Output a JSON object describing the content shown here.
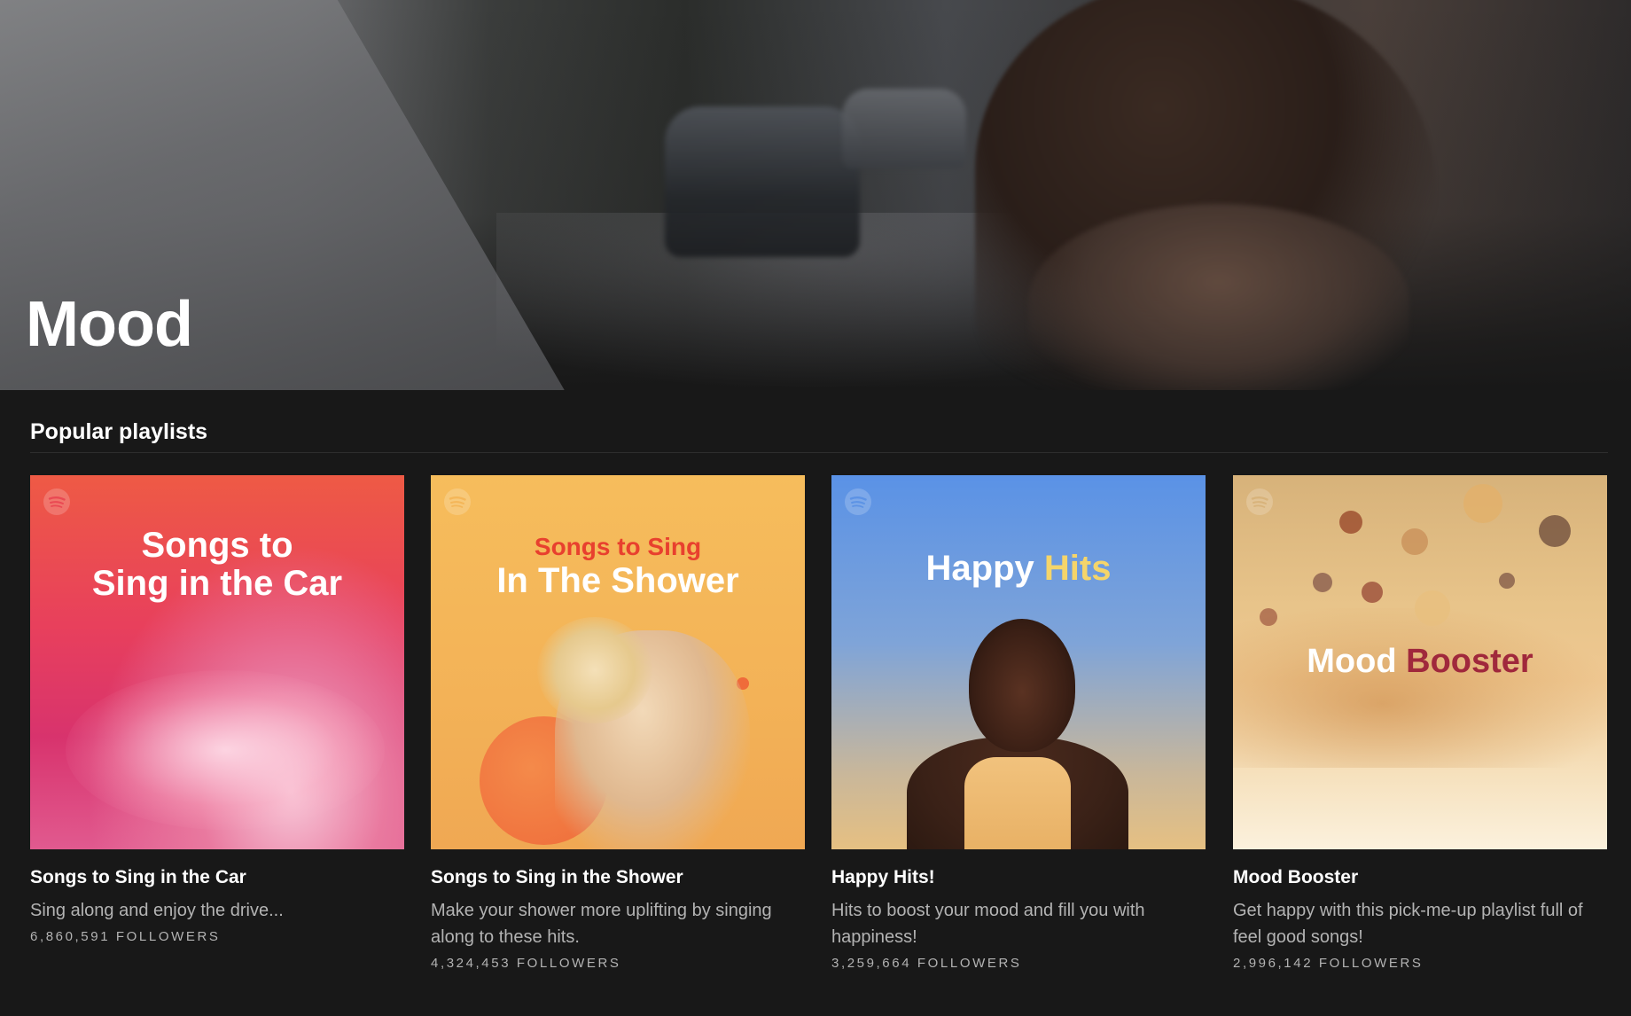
{
  "header": {
    "title": "Mood"
  },
  "section": {
    "title": "Popular playlists"
  },
  "playlists": [
    {
      "title": "Songs to Sing in the Car",
      "description": "Sing along and enjoy the drive...",
      "followers": "6,860,591 FOLLOWERS",
      "cover_line1": "Songs to",
      "cover_line2": "Sing in the Car"
    },
    {
      "title": "Songs to Sing in the Shower",
      "description": "Make your shower more uplifting by singing along to these hits.",
      "followers": "4,324,453 FOLLOWERS",
      "cover_line1": "Songs to Sing",
      "cover_line2": "In The Shower"
    },
    {
      "title": "Happy Hits!",
      "description": "Hits to boost your mood and fill you with happiness!",
      "followers": "3,259,664 FOLLOWERS",
      "cover_word1": "Happy",
      "cover_word2": "Hits"
    },
    {
      "title": "Mood Booster",
      "description": "Get happy with this pick-me-up playlist full of feel good songs!",
      "followers": "2,996,142 FOLLOWERS",
      "cover_word1": "Mood",
      "cover_word2": "Booster"
    }
  ],
  "colors": {
    "background": "#181818",
    "text_primary": "#ffffff",
    "text_secondary": "#b3b3b3"
  }
}
